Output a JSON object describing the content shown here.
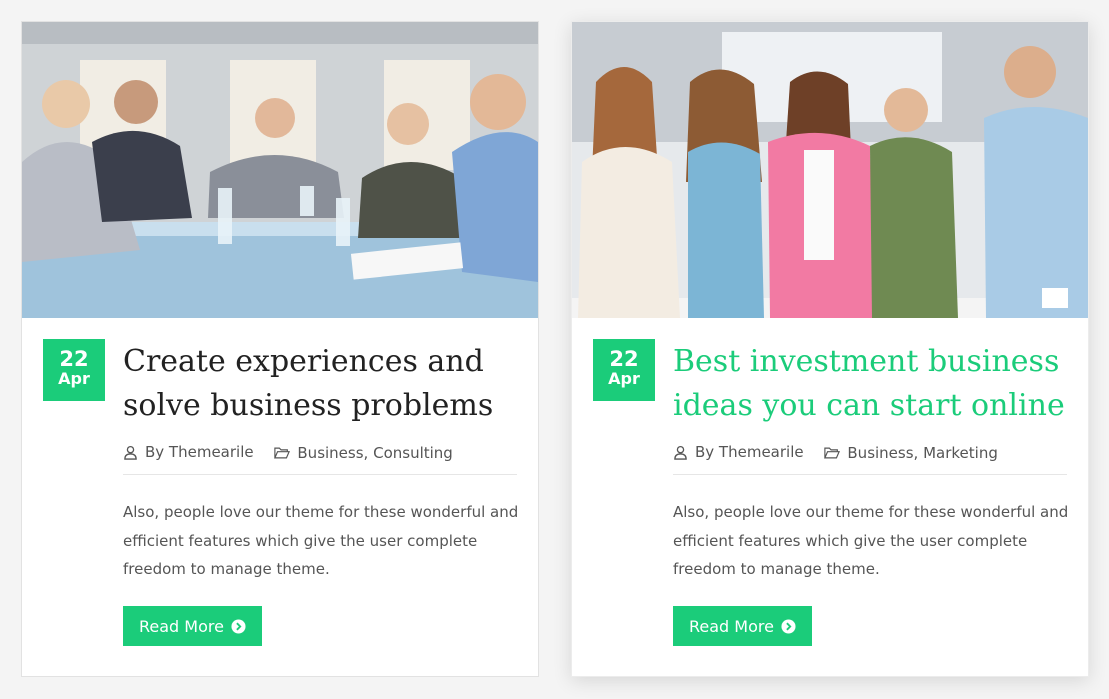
{
  "posts": [
    {
      "date": {
        "day": "22",
        "month": "Apr"
      },
      "title": "Create experiences and solve business problems",
      "author": "By Themearile",
      "categories": [
        "Business",
        "Consulting"
      ],
      "excerpt": "Also, people love our theme for these wonderful and efficient features which give the user complete freedom to manage theme.",
      "read_more": "Read More",
      "image": "business-meeting-photo"
    },
    {
      "date": {
        "day": "22",
        "month": "Apr"
      },
      "title": "Best investment business ideas you can start online",
      "author": "By Themearile",
      "categories": [
        "Business",
        "Marketing"
      ],
      "excerpt": "Also, people love our theme for these wonderful and efficient features which give the user complete freedom to manage theme.",
      "read_more": "Read More",
      "image": "young-team-photo"
    }
  ],
  "colors": {
    "accent": "#1bcc7a",
    "title": "#222222",
    "text": "#555555"
  },
  "icons": {
    "author": "user-icon",
    "categories": "folder-icon",
    "read_more": "arrow-circle-right-icon"
  }
}
